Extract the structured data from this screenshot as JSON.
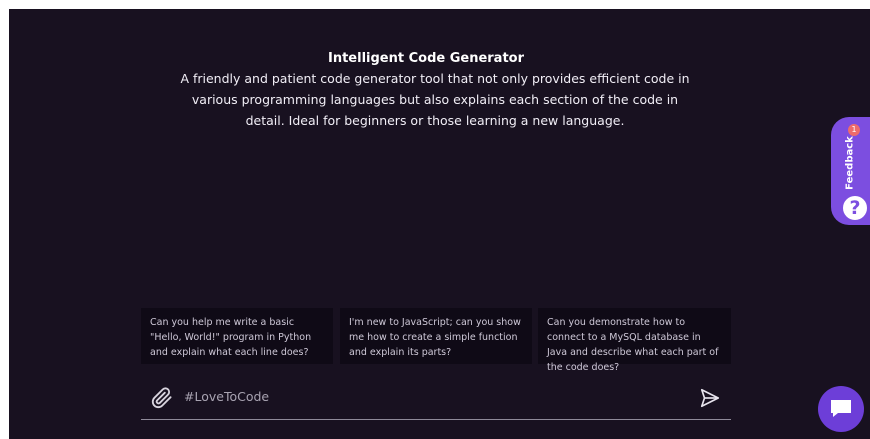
{
  "header": {
    "title": "Intelligent Code Generator",
    "description": "A friendly and patient code generator tool that not only provides efficient code in various programming languages but also explains each section of the code in detail. Ideal for beginners or those learning a new language."
  },
  "suggestions": [
    {
      "text": "Can you help me write a basic \"Hello, World!\" program in Python and explain what each line does?"
    },
    {
      "text": "I'm new to JavaScript; can you show me how to create a simple function and explain its parts?"
    },
    {
      "text": "Can you demonstrate how to connect to a MySQL database in Java and describe what each part of the code does?"
    }
  ],
  "composer": {
    "placeholder": "#LoveToCode",
    "value": "",
    "attach_icon": "paperclip-icon",
    "send_icon": "send-icon"
  },
  "feedback": {
    "label": "Feedback",
    "badge_count": "1",
    "help_glyph": "?"
  },
  "chat_widget": {
    "icon": "chat-bubble-icon"
  },
  "colors": {
    "background": "#181120",
    "card": "#0f0a16",
    "accent": "#7c4ee0",
    "chat_button": "#6d3ed8",
    "badge": "#ee6b6b"
  }
}
